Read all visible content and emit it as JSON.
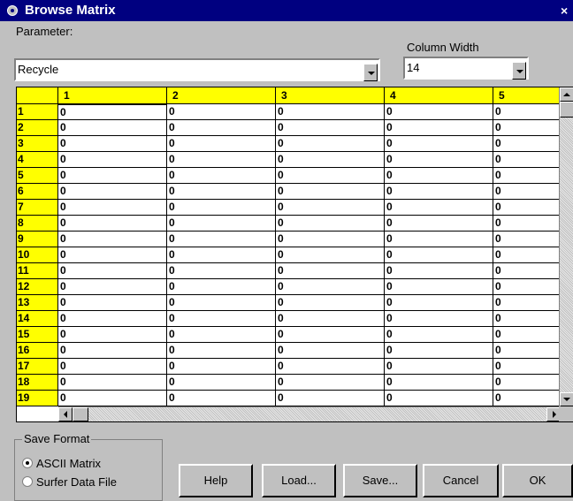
{
  "window": {
    "title": "Browse Matrix",
    "close_label": "×"
  },
  "parameter": {
    "label": "Parameter:",
    "value": "Recycle"
  },
  "column_width": {
    "label": "Column Width",
    "value": "14"
  },
  "grid": {
    "columns": [
      "1",
      "2",
      "3",
      "4",
      "5"
    ],
    "rows": [
      "1",
      "2",
      "3",
      "4",
      "5",
      "6",
      "7",
      "8",
      "9",
      "10",
      "11",
      "12",
      "13",
      "14",
      "15",
      "16",
      "17",
      "18",
      "19"
    ],
    "cell_value": "0",
    "header_color": "#ffff00"
  },
  "save_format": {
    "title": "Save Format",
    "options": [
      {
        "label": "ASCII Matrix",
        "selected": true
      },
      {
        "label": "Surfer Data File",
        "selected": false
      }
    ]
  },
  "buttons": {
    "help": "Help",
    "load": "Load...",
    "save": "Save...",
    "cancel": "Cancel",
    "ok": "OK"
  }
}
